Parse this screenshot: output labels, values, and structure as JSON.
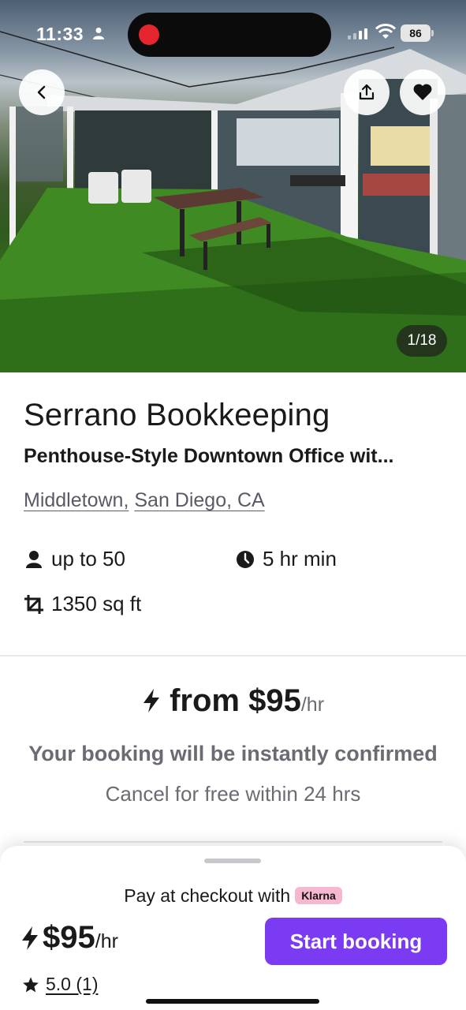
{
  "status_bar": {
    "time": "11:33",
    "battery": "86"
  },
  "hero": {
    "photo_counter": "1/18"
  },
  "listing": {
    "title": "Serrano Bookkeeping",
    "subtitle": "Penthouse-Style Downtown Office wit...",
    "location_part1": "Middletown,",
    "location_part2": "San Diego, CA",
    "capacity": "up to 50",
    "min_hours": "5 hr min",
    "area": "1350 sq ft"
  },
  "pricing": {
    "from_price": "from $95",
    "unit": "/hr",
    "instant_text": "Your booking will be instantly confirmed",
    "cancel_text": "Cancel for free within 24 hrs"
  },
  "sheet": {
    "pay_text": "Pay at checkout with",
    "klarna_label": "Klarna",
    "price": "$95",
    "unit": "/hr",
    "rating": "5.0 (1)",
    "cta_label": "Start booking"
  },
  "colors": {
    "accent": "#7b3bf2",
    "klarna": "#f5b8d0",
    "muted_text": "#6b6b73"
  },
  "icons": [
    "back-arrow-icon",
    "share-icon",
    "heart-icon",
    "person-icon",
    "clock-icon",
    "crop-area-icon",
    "lightning-icon",
    "star-icon",
    "wifi-icon"
  ]
}
